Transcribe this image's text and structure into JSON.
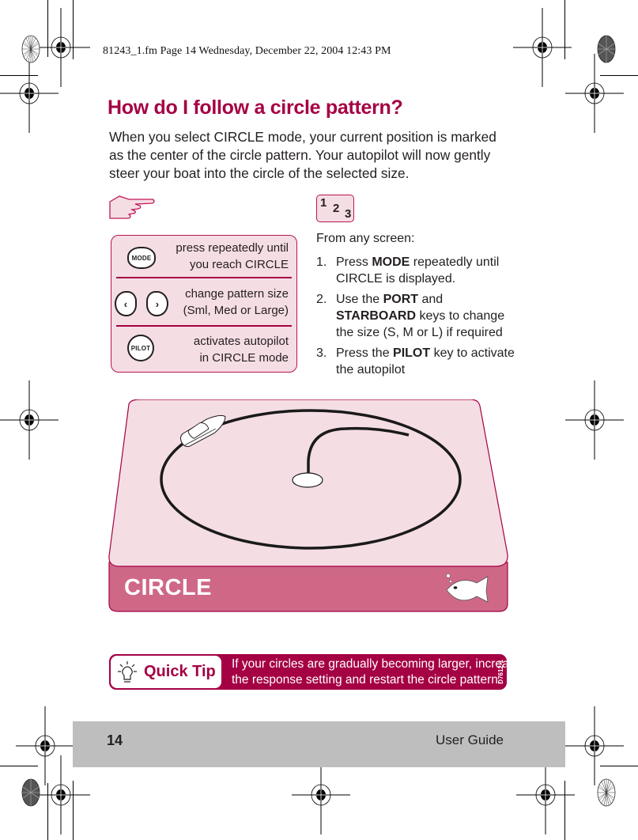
{
  "print_header": "81243_1.fm  Page 14  Wednesday, December 22, 2004  12:43 PM",
  "page": {
    "title": "How do I follow a circle pattern?",
    "intro": "When you select CIRCLE mode, your current position is marked as the center of the circle pattern. Your autopilot will now gently steer your boat into the circle of the selected size."
  },
  "icons": {
    "pointer": "pointing-hand-icon",
    "steps": "numbered-steps-icon",
    "tip": "lightbulb-icon",
    "fish": "fish-icon",
    "boat": "boat-icon"
  },
  "keys_panel": {
    "rows": [
      {
        "keys": [
          "MODE"
        ],
        "description_line1": "press repeatedly until",
        "description_line2": "you reach CIRCLE"
      },
      {
        "keys": [
          "‹",
          "›"
        ],
        "description_line1": "change pattern size",
        "description_line2": "(Sml, Med or Large)"
      },
      {
        "keys": [
          "PILOT"
        ],
        "description_line1": "activates autopilot",
        "description_line2": "in CIRCLE mode"
      }
    ]
  },
  "steps_badge": [
    "1",
    "2",
    "3"
  ],
  "steps": {
    "intro": "From any screen:",
    "items": [
      {
        "num": "1.",
        "pre": "Press ",
        "bold": "MODE",
        "post": " repeatedly until CIRCLE is displayed."
      },
      {
        "num": "2.",
        "pre": "Use the ",
        "bold": "PORT",
        "mid": " and ",
        "bold2": "STARBOARD",
        "post": " keys to change the size (S, M or L) if required"
      },
      {
        "num": "3.",
        "pre": "Press the ",
        "bold": "PILOT",
        "post": " key to activate the autopilot"
      }
    ]
  },
  "diagram": {
    "label": "CIRCLE"
  },
  "quick_tip": {
    "label": "Quick Tip",
    "line1": "If your circles are gradually becoming larger, increase",
    "line2": "the response setting and restart the circle pattern.",
    "code": "D7612-1"
  },
  "footer": {
    "page_number": "14",
    "title": "User Guide"
  },
  "colors": {
    "brand": "#a50044",
    "panel_fill": "#f5dde4",
    "band_fill": "#cf6887",
    "footer_gray": "#bebebe"
  }
}
